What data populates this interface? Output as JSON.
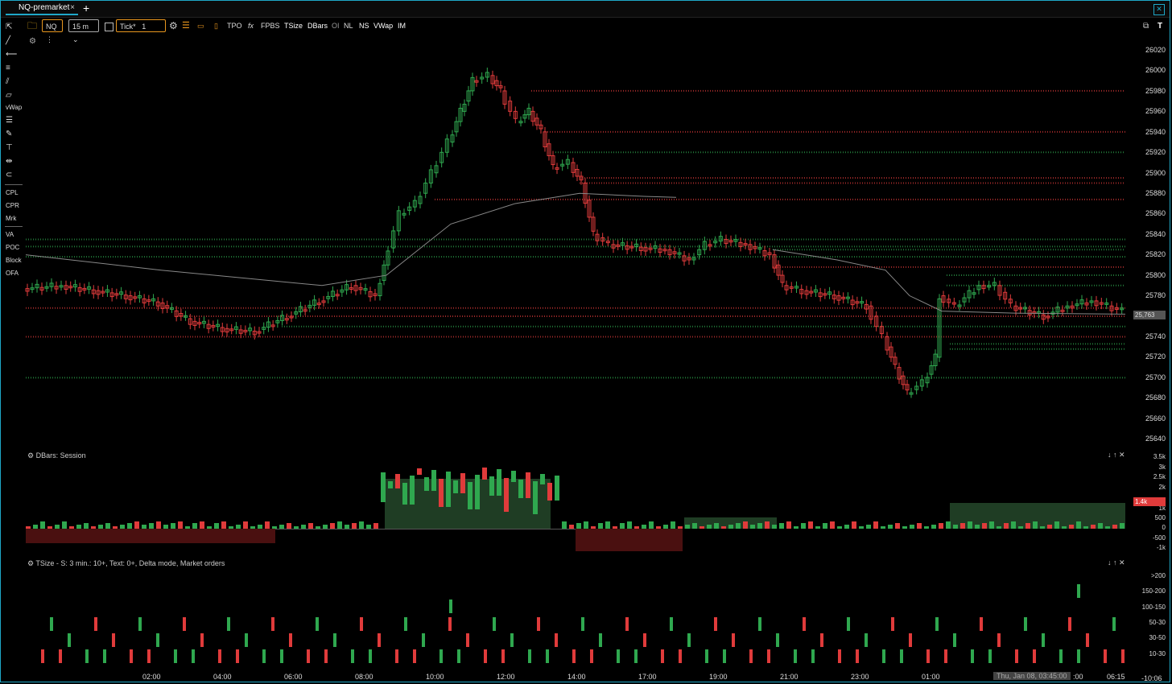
{
  "tab": {
    "title": "NQ-premarket",
    "close": "×",
    "add": "+"
  },
  "window": {
    "close": "✕"
  },
  "toolbar": {
    "symbol": "NQ",
    "interval": "15 m",
    "chart_type_label": "Tick",
    "chart_type_value": "1",
    "items": [
      "TPO",
      "FPBS",
      "TSize",
      "DBars",
      "OI",
      "NL",
      "NS",
      "VWap",
      "IM"
    ],
    "right_icons": [
      "screenshot-icon",
      "text-icon"
    ]
  },
  "left_toolbar": {
    "text_items": [
      "vWap",
      "CPL",
      "CPR",
      "Mrk",
      "VA",
      "POC",
      "Block",
      "OFA"
    ]
  },
  "price_axis": {
    "ticks": [
      "26020",
      "26000",
      "25980",
      "25960",
      "25940",
      "25920",
      "25900",
      "25880",
      "25860",
      "25840",
      "25820",
      "25800",
      "25780",
      "25760",
      "25740",
      "25720",
      "25700",
      "25680",
      "25660",
      "25640"
    ],
    "last_price": "25,763",
    "last_price_color": "#555555"
  },
  "dbars_panel": {
    "title": "DBars: Session",
    "ticks": [
      "3.5k",
      "3k",
      "2.5k",
      "2k",
      "1.5k",
      "1k",
      "500",
      "0",
      "-500",
      "-1k"
    ],
    "last_value": "1.4k",
    "last_value_color": "#e03b3b"
  },
  "tsize_panel": {
    "title": "TSize - S: 3 min.: 10+, Text: 0+, Delta mode,  Market orders",
    "ticks": [
      ">200",
      "150-200",
      "100-150",
      "50-30",
      "30-50",
      "10-30"
    ]
  },
  "time_axis": {
    "labels": [
      "02:00",
      "04:00",
      "06:00",
      "08:00",
      "10:00",
      "12:00",
      "14:00",
      "17:00",
      "19:00",
      "21:00",
      "23:00",
      "01:00",
      ":00",
      "06:15"
    ],
    "crosshair_label": "Thu, Jan 08, 03:45:00",
    "corner_label": "-10:06"
  },
  "colors": {
    "up": "#2fa84f",
    "down": "#e03b3b",
    "accent": "#1fa8c8"
  }
}
